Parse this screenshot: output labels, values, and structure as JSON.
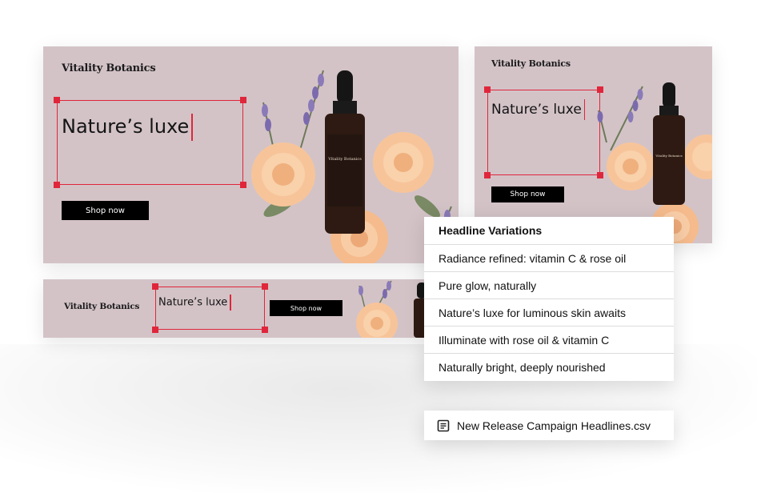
{
  "brand_name": "Vitality Botanics",
  "headline_text": "Nature’s luxe",
  "button_label": "Shop now",
  "bottle_label": "Vitality Botanics",
  "colors": {
    "banner_bg": "#d3c3c7",
    "selection": "#e0263b",
    "button_bg": "#000000",
    "rose": "#f7c49a",
    "lavender": "#8a7ab8",
    "bottle": "#3a1e14"
  },
  "variations_panel": {
    "title": "Headline Variations",
    "items": [
      "Radiance refined: vitamin C & rose oil",
      "Pure glow, naturally",
      "Nature’s luxe for luminous skin awaits",
      "Illuminate with rose oil  & vitamin C",
      "Naturally bright, deeply nourished"
    ]
  },
  "file": {
    "icon": "document-icon",
    "name": "New Release Campaign Headlines.csv"
  }
}
